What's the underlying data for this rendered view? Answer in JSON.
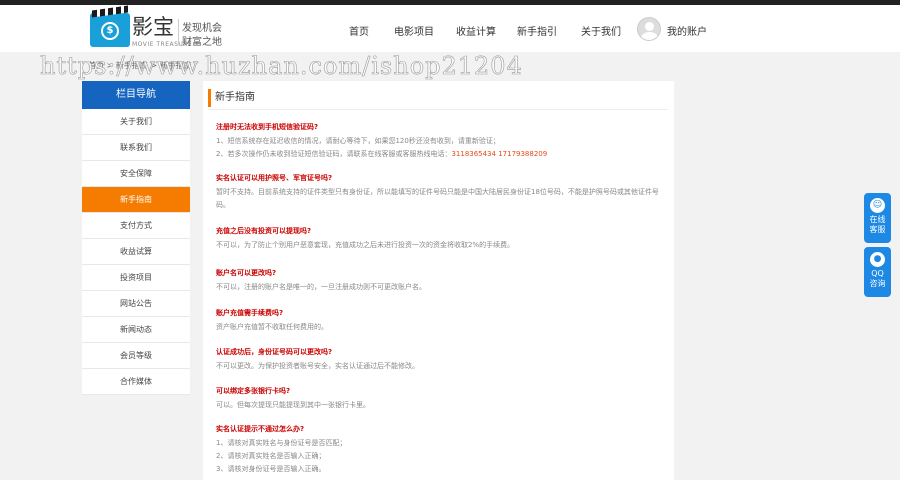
{
  "header": {
    "logo_cn": "影宝",
    "logo_en": "MOVIE TREASURE",
    "logo_slogan_1": "发现机会",
    "logo_slogan_2": "财富之地",
    "nav": [
      "首页",
      "电影项目",
      "收益计算",
      "新手指引",
      "关于我们"
    ],
    "account": "我的账户"
  },
  "breadcrumb": "首页 > 新手指南 > 新手指南",
  "watermark": "https://www.huzhan.com/ishop21204",
  "sidebar": {
    "heading": "栏目导航",
    "items": [
      "关于我们",
      "联系我们",
      "安全保障",
      "新手指南",
      "支付方式",
      "收益试算",
      "投资项目",
      "网站公告",
      "新闻动态",
      "会员等级",
      "合作媒体"
    ],
    "active_index": 3
  },
  "main": {
    "title": "新手指南",
    "qa": [
      {
        "q": "注册时无法收到手机短信验证码?",
        "a": [
          "1、短信系统存在延迟收信的情况，请耐心等待下，如果您120秒还没有收到，请重新验证；",
          "2、若多次操作仍未收到验证短信验证码，请联系在线客服或客服热线电话：3118365434 17179388209"
        ]
      },
      {
        "q": "实名认证可以用护照号、军官证号吗?",
        "a": [
          "暂时不支持。目前系统支持的证件类型只有身份证，所以能填写的证件号码只能是中国大陆居民身份证18位号码，不能是护照号码或其他证件号码。"
        ]
      },
      {
        "q": "充值之后没有投资可以提现吗?",
        "a": [
          "不可以，为了防止个别用户恶意套现，充值成功之后未进行投资一次的资金将收取2%的手续费。"
        ]
      },
      {
        "q": "账户名可以更改吗?",
        "a": [
          "不可以，注册的账户名是唯一的，一旦注册成功则不可更改账户名。"
        ]
      },
      {
        "q": "账户充值需手续费吗?",
        "a": [
          "资产账户充值暂不收取任何费用的。"
        ]
      },
      {
        "q": "认证成功后，身份证号码可以更改吗?",
        "a": [
          "不可以更改。为保护投资者账号安全，实名认证通过后不能修改。"
        ]
      },
      {
        "q": "可以绑定多张银行卡吗?",
        "a": [
          "可以。但每次提现只能提现到其中一张银行卡里。"
        ]
      },
      {
        "q": "实名认证提示不通过怎么办?",
        "a": [
          "1、请核对真实姓名与身份证号是否匹配；",
          "2、请核对真实姓名是否输入正确；",
          "3、请核对身份证号是否输入正确。"
        ]
      }
    ]
  },
  "float": {
    "service_label_1": "在线",
    "service_label_2": "客服",
    "qq_label_1": "QQ",
    "qq_label_2": "咨询"
  },
  "colors": {
    "brand_blue": "#1565c0",
    "accent_orange": "#f57c00",
    "question_red": "#cc0000"
  }
}
